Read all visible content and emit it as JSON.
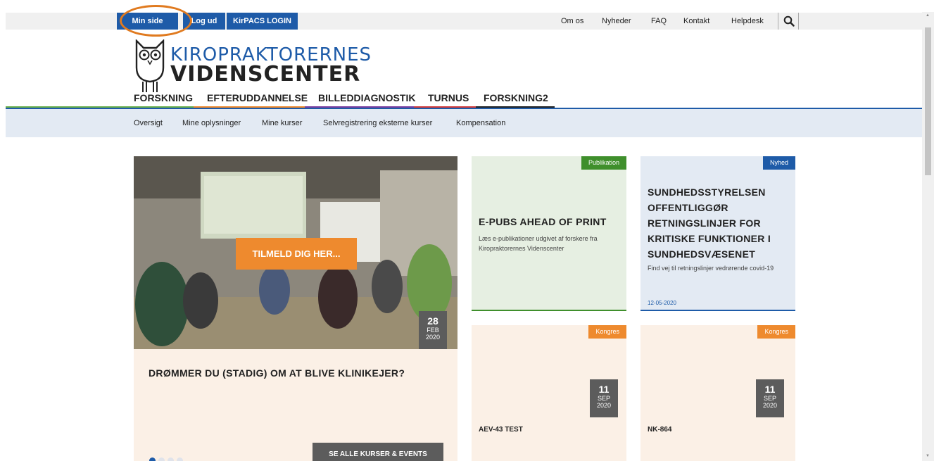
{
  "topbar": {
    "min_side": "Min side",
    "log_ud": "Log ud",
    "kirpacs": "KirPACS LOGIN",
    "links": [
      "Om os",
      "Nyheder",
      "FAQ",
      "Kontakt",
      "Helpdesk"
    ]
  },
  "logo": {
    "line1": "KIROPRAKTORERNES",
    "line2": "VIDENSCENTER"
  },
  "mainnav": {
    "items": [
      {
        "label": "FORSKNING",
        "color": "#6ab04c"
      },
      {
        "label": "EFTERUDDANNELSE",
        "color": "#ee8a2e"
      },
      {
        "label": "BILLEDDIAGNOSTIK",
        "color": "#7b3fa0"
      },
      {
        "label": "TURNUS",
        "color": "#d23c3c"
      },
      {
        "label": "FORSKNING2",
        "color": "#222222"
      }
    ]
  },
  "subnav": {
    "items": [
      "Oversigt",
      "Mine oplysninger",
      "Mine kurser",
      "Selvregistrering eksterne kurser",
      "Kompensation"
    ]
  },
  "hero": {
    "cta": "TILMELD DIG HER...",
    "date_day": "28",
    "date_month": "FEB",
    "date_year": "2020",
    "title": "DRØMMER DU (STADIG) OM AT BLIVE KLINIKEJER?",
    "button": "SE ALLE KURSER & EVENTS"
  },
  "cards": [
    {
      "tag": "Publikation",
      "tag_color": "#3f8f2c",
      "title": "E-PUBS AHEAD OF PRINT",
      "text": "Læs e-publikationer udgivet af forskere fra Kiropraktorernes Videnscenter"
    },
    {
      "tag": "Nyhed",
      "tag_color": "#1e5ba8",
      "title": "SUNDHEDSSTYRELSEN OFFENTLIGGØR RETNINGSLINJER FOR KRITISKE FUNKTIONER I SUNDHEDSVÆSENET",
      "text": "Find vej til retningslinjer vedrørende covid-19",
      "date": "12-05-2020"
    },
    {
      "tag": "Kongres",
      "tag_color": "#ee8a2e",
      "date_day": "11",
      "date_month": "SEP",
      "date_year": "2020",
      "title": "AEV-43 TEST"
    },
    {
      "tag": "Kongres",
      "tag_color": "#ee8a2e",
      "date_day": "11",
      "date_month": "SEP",
      "date_year": "2020",
      "title": "NK-864"
    }
  ]
}
